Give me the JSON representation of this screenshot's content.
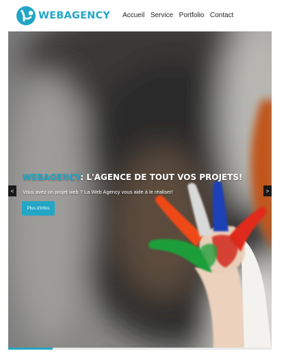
{
  "brand": {
    "name": "WEBAGENCY",
    "color": "#23a6c6",
    "logo_icon": "person-circle-logo-icon"
  },
  "nav": {
    "items": [
      {
        "label": "Accueil"
      },
      {
        "label": "Service"
      },
      {
        "label": "Portfolio"
      },
      {
        "label": "Contact"
      }
    ]
  },
  "hero": {
    "title_accent": "WEBAGENCY",
    "title_rest": ": L'AGENCE DE TOUT VOS PROJETS!",
    "subtitle": "Vous avez un projet web ? La Web Agency vous aide à le réaliser!",
    "button_label": "Plus d'infos",
    "prev_label": "<",
    "next_label": ">",
    "prev_icon": "chevron-left-icon",
    "next_icon": "chevron-right-icon",
    "slide_progress": 0.17
  }
}
